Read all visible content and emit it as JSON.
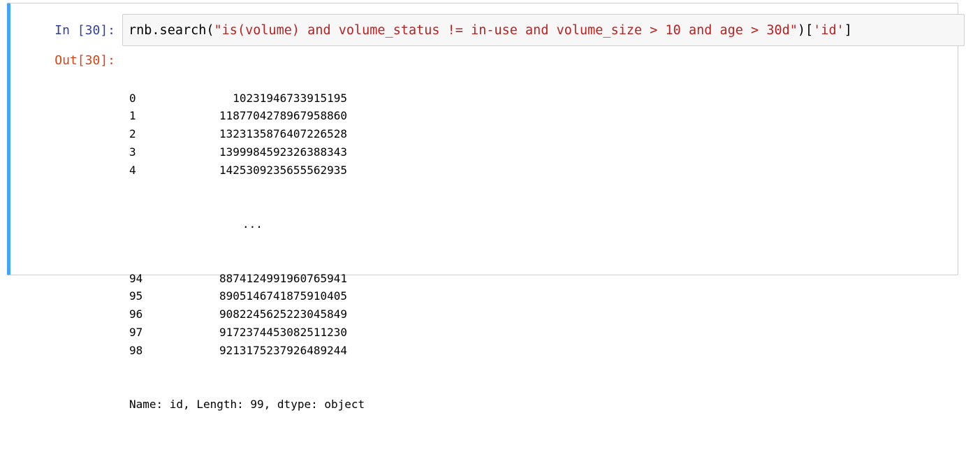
{
  "cell": {
    "in_prompt": "In [30]:",
    "out_prompt": "Out[30]:",
    "code": {
      "prefix": "rnb.search(",
      "query_string": "\"is(volume) and volume_status != in-use and volume_size > 10 and age > 30d\"",
      "middle": ")[",
      "key_string": "'id'",
      "suffix": "]"
    },
    "output": {
      "head_rows": [
        {
          "index": "0",
          "value": "10231946733915195"
        },
        {
          "index": "1",
          "value": "1187704278967958860"
        },
        {
          "index": "2",
          "value": "1323135876407226528"
        },
        {
          "index": "3",
          "value": "1399984592326388343"
        },
        {
          "index": "4",
          "value": "1425309235655562935"
        }
      ],
      "ellipsis": "...",
      "tail_rows": [
        {
          "index": "94",
          "value": "8874124991960765941"
        },
        {
          "index": "95",
          "value": "8905146741875910405"
        },
        {
          "index": "96",
          "value": "9082245625223045849"
        },
        {
          "index": "97",
          "value": "9172374453082511230"
        },
        {
          "index": "98",
          "value": "9213175237926489244"
        }
      ],
      "footer": "Name: id, Length: 99, dtype: object"
    }
  },
  "colors": {
    "selected_cell_border": "#42a5f5",
    "in_prompt": "#303f9f",
    "out_prompt": "#d84315",
    "string_literal": "#ba2121",
    "input_background": "#f7f7f7"
  }
}
